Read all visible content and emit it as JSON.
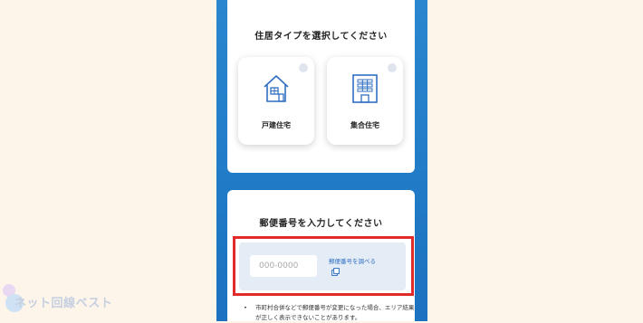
{
  "residence_section": {
    "title": "住居タイプを選択してください",
    "options": [
      {
        "label": "戸建住宅",
        "icon": "house-icon"
      },
      {
        "label": "集合住宅",
        "icon": "apartment-icon"
      }
    ]
  },
  "postal_section": {
    "title": "郵便番号を入力してください",
    "input_placeholder": "000-0000",
    "lookup_link": "郵便番号を調べる",
    "lookup_icon": "external-link-icon",
    "notes": [
      "市町村合併などで郵便番号が変更になった場合、エリア結果が正しく表示できないことがあります。"
    ]
  },
  "watermark": {
    "text": "ネット回線ベスト"
  },
  "colors": {
    "background": "#fdf5ea",
    "phone_blue": "#1b72c0",
    "accent_blue": "#2f6fc2",
    "highlight_red": "#e12a2a",
    "input_panel": "#e4ecf6"
  }
}
